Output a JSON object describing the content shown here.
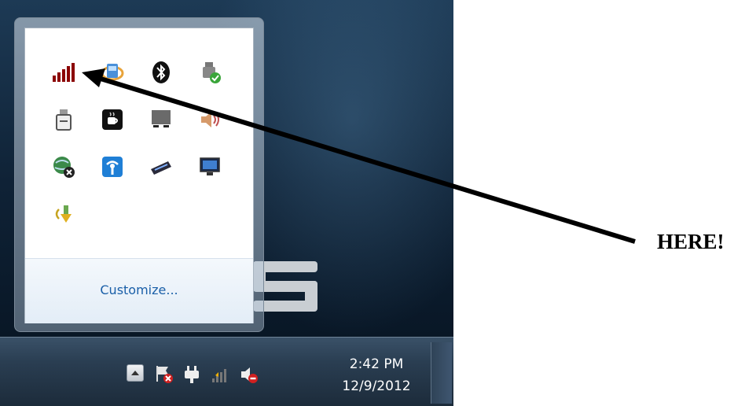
{
  "flyout": {
    "icons": [
      {
        "name": "signal-strength-icon"
      },
      {
        "name": "windows-live-icon"
      },
      {
        "name": "bluetooth-icon"
      },
      {
        "name": "usb-plug-ok-icon"
      },
      {
        "name": "usb-drive-icon"
      },
      {
        "name": "coffee-cup-icon"
      },
      {
        "name": "monitor-icon"
      },
      {
        "name": "speaker-icon"
      },
      {
        "name": "globe-network-icon"
      },
      {
        "name": "wireless-info-icon"
      },
      {
        "name": "tablet-pen-icon"
      },
      {
        "name": "display-settings-icon"
      },
      {
        "name": "sync-arrow-icon"
      }
    ],
    "customize_label": "Customize..."
  },
  "taskbar": {
    "tray_icons": [
      "show-hidden-icons-icon",
      "action-center-flag-icon",
      "power-plug-icon",
      "network-signal-icon",
      "volume-muted-icon"
    ],
    "clock_time": "2:42 PM",
    "clock_date": "12/9/2012"
  },
  "annotation": {
    "label": "HERE!"
  }
}
